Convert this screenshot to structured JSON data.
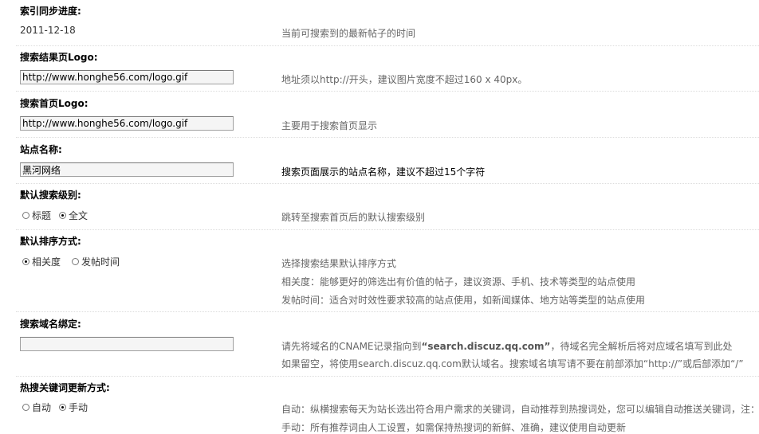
{
  "index_progress": {
    "title": "索引同步进度:",
    "value": "2011-12-18",
    "tip": "当前可搜索到的最新帖子的时间"
  },
  "result_logo": {
    "title": "搜索结果页Logo:",
    "value": "http://www.honghe56.com/logo.gif",
    "tip": "地址须以http://开头，建议图片宽度不超过160 x 40px。"
  },
  "home_logo": {
    "title": "搜索首页Logo:",
    "value": "http://www.honghe56.com/logo.gif",
    "tip": "主要用于搜索首页显示"
  },
  "site_name": {
    "title": "站点名称:",
    "value": "黑河网络",
    "tip": "搜索页面展示的站点名称，建议不超过15个字符"
  },
  "default_level": {
    "title": "默认搜索级别:",
    "options": [
      "标题",
      "全文"
    ],
    "selected": "全文",
    "tip": "跳转至搜索首页后的默认搜索级别"
  },
  "default_sort": {
    "title": "默认排序方式:",
    "options": [
      "相关度",
      "发帖时间"
    ],
    "selected": "相关度",
    "tips": [
      "选择搜索结果默认排序方式",
      "相关度：能够更好的筛选出有价值的帖子，建议资源、手机、技术等类型的站点使用",
      "发帖时间：适合对时效性要求较高的站点使用，如新闻媒体、地方站等类型的站点使用"
    ]
  },
  "domain_bind": {
    "title": "搜索域名绑定:",
    "value": "",
    "tip1_pre": "请先将域名的CNAME记录指向到",
    "tip1_strong": "“search.discuz.qq.com”",
    "tip1_post": "，待域名完全解析后将对应域名填写到此处",
    "tip2": "如果留空，将使用search.discuz.qq.com默认域名。搜索域名填写请不要在前部添加“http://”或后部添加“/”"
  },
  "hot_keyword": {
    "title": "热搜关键词更新方式:",
    "options": [
      "自动",
      "手动"
    ],
    "selected": "手动",
    "tips": [
      "自动：纵横搜索每天为站长选出符合用户需求的关键词，自动推荐到热搜词处，您可以编辑自动推送关键词，注：",
      "手动：所有推荐词由人工设置，如需保持热搜词的新鲜、准确，建议使用自动更新"
    ]
  }
}
